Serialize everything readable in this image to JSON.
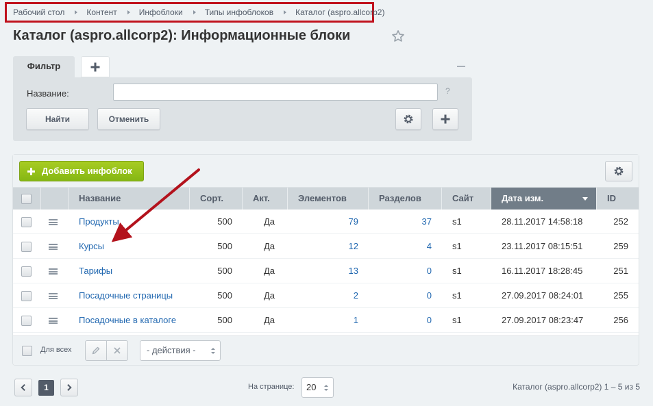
{
  "breadcrumb": [
    "Рабочий стол",
    "Контент",
    "Инфоблоки",
    "Типы инфоблоков",
    "Каталог (aspro.allcorp2)"
  ],
  "page": {
    "title": "Каталог (aspro.allcorp2): Информационные блоки"
  },
  "filter": {
    "tab_label": "Фильтр",
    "name_label": "Название:",
    "name_value": "",
    "help": "?",
    "find_button": "Найти",
    "cancel_button": "Отменить"
  },
  "toolbar": {
    "add_button": "Добавить инфоблок"
  },
  "table": {
    "columns": [
      "Название",
      "Сорт.",
      "Акт.",
      "Элементов",
      "Разделов",
      "Сайт",
      "Дата изм.",
      "ID"
    ],
    "sorted_column": "Дата изм.",
    "rows": [
      {
        "name": "Продукты",
        "sort": "500",
        "active": "Да",
        "elements": "79",
        "sections": "37",
        "site": "s1",
        "date": "28.11.2017 14:58:18",
        "id": "252"
      },
      {
        "name": "Курсы",
        "sort": "500",
        "active": "Да",
        "elements": "12",
        "sections": "4",
        "site": "s1",
        "date": "23.11.2017 08:15:51",
        "id": "259"
      },
      {
        "name": "Тарифы",
        "sort": "500",
        "active": "Да",
        "elements": "13",
        "sections": "0",
        "site": "s1",
        "date": "16.11.2017 18:28:45",
        "id": "251"
      },
      {
        "name": "Посадочные страницы",
        "sort": "500",
        "active": "Да",
        "elements": "2",
        "sections": "0",
        "site": "s1",
        "date": "27.09.2017 08:24:01",
        "id": "255"
      },
      {
        "name": "Посадочные в каталоге",
        "sort": "500",
        "active": "Да",
        "elements": "1",
        "sections": "0",
        "site": "s1",
        "date": "27.09.2017 08:23:47",
        "id": "256"
      }
    ]
  },
  "footer": {
    "for_all_label": "Для всех",
    "actions_select": "- действия -"
  },
  "pagination": {
    "current_page": "1",
    "per_page_label": "На странице:",
    "per_page_value": "20",
    "summary": "Каталог (aspro.allcorp2) 1 – 5 из 5"
  },
  "colors": {
    "highlight": "#c0121d",
    "link": "#2067b0",
    "add_button": "#92bf1a",
    "sorted_header": "#717d88"
  }
}
